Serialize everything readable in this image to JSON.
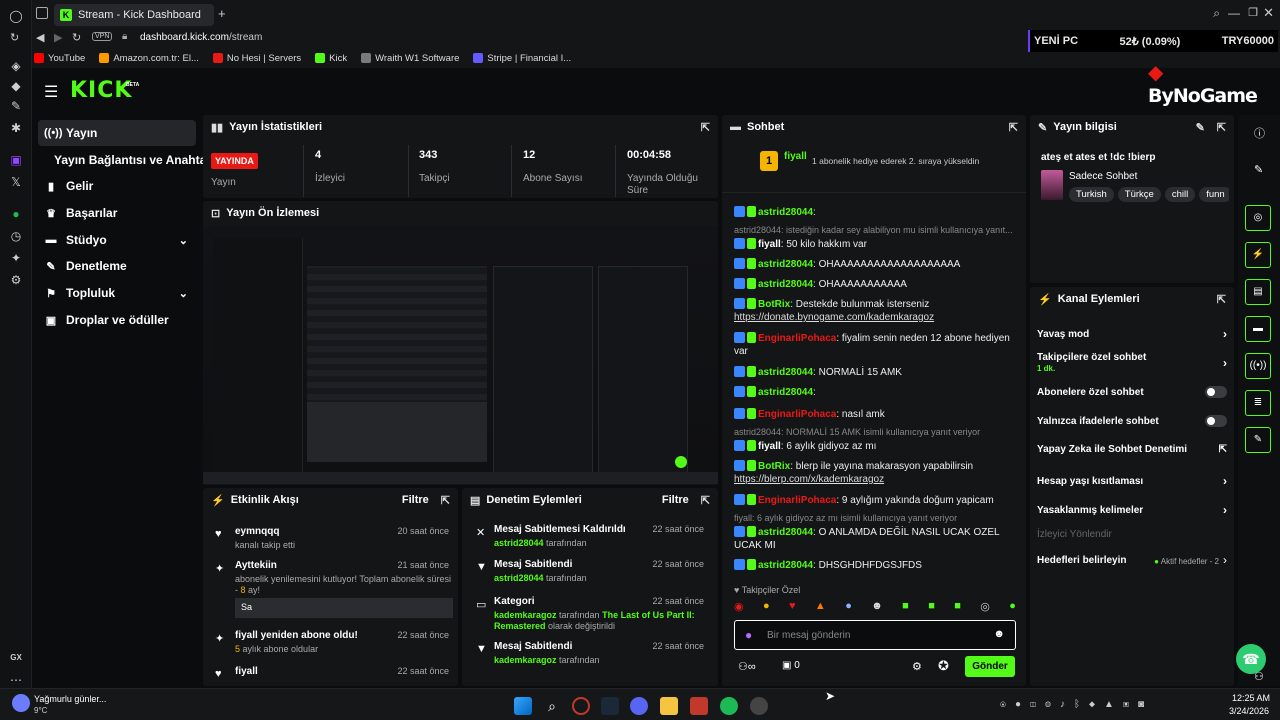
{
  "browser": {
    "tab_title": "Stream - Kick Dashboard",
    "vpn_label": "VPN",
    "url_domain": "dashboard.kick.com",
    "url_path": "/stream",
    "bookmarks": [
      {
        "label": "YouTube",
        "color": "#ff0000"
      },
      {
        "label": "Amazon.com.tr: El...",
        "color": "#ff9900"
      },
      {
        "label": "No Hesi | Servers",
        "color": "#e91916"
      },
      {
        "label": "Kick",
        "color": "#53fc18"
      },
      {
        "label": "Wraith W1 Software",
        "color": "#7a7a7a"
      },
      {
        "label": "Stripe | Financial I...",
        "color": "#635bff"
      }
    ]
  },
  "ticker": {
    "left": "YENİ PC",
    "mid": "52₺ (0.09%)",
    "right": "TRY60000"
  },
  "overlay_brand": {
    "name": "ByNoGame"
  },
  "brand": {
    "logo": "KICK",
    "beta": "BETA"
  },
  "sidenav": {
    "items": [
      {
        "label": "Yayın",
        "icon": "broadcast-icon"
      },
      {
        "label": "Yayın Bağlantısı ve Anahtarı",
        "icon": ""
      },
      {
        "label": "Gelir",
        "icon": "chart-icon"
      },
      {
        "label": "Başarılar",
        "icon": "trophy-icon"
      },
      {
        "label": "Stüdyo",
        "icon": "studio-icon"
      },
      {
        "label": "Denetleme",
        "icon": "wrench-icon"
      },
      {
        "label": "Topluluk",
        "icon": "people-icon"
      },
      {
        "label": "Droplar ve ödüller",
        "icon": "gift-icon"
      }
    ]
  },
  "stats": {
    "title": "Yayın İstatistikleri",
    "live_badge": "YAYINDA",
    "live_label": "Yayın",
    "viewers_value": "4",
    "viewers_label": "İzleyici",
    "followers_value": "343",
    "followers_label": "Takipçi",
    "subs_value": "12",
    "subs_label": "Abone Sayısı",
    "uptime_value": "00:04:58",
    "uptime_label": "Yayında Olduğu Süre"
  },
  "preview": {
    "title": "Yayın Ön İzlemesi"
  },
  "activity": {
    "title": "Etkinlik Akışı",
    "filter": "Filtre",
    "items": [
      {
        "name": "eymnqqq",
        "time": "20 saat önce",
        "sub": "kanalı takip etti"
      },
      {
        "name": "Ayttekiin",
        "time": "21 saat önce",
        "sub": "abonelik yenilemesini kutluyor! Toplam abonelik süresi -",
        "sub2": "8",
        "sub3": " ay!",
        "msg": "Sa"
      },
      {
        "name": "fiyall yeniden abone oldu!",
        "time": "22 saat önce",
        "sub2": "5",
        "sub": " aylık abone oldular"
      },
      {
        "name": "fiyall",
        "time": "22 saat önce"
      }
    ]
  },
  "modlog": {
    "title": "Denetim Eylemleri",
    "filter": "Filtre",
    "items": [
      {
        "title": "Mesaj Sabitlemesi Kaldırıldı",
        "time": "22 saat önce",
        "who": "astrid28044",
        "by": " tarafından"
      },
      {
        "title": "Mesaj Sabitlendi",
        "time": "22 saat önce",
        "who": "astrid28044",
        "by": " tarafından"
      },
      {
        "title": "Kategori",
        "time": "22 saat önce",
        "who": "kademkaragoz",
        "by": " tarafından ",
        "game": "The Last of Us Part II: Remastered",
        "tail": " olarak değiştirildi"
      },
      {
        "title": "Mesaj Sabitlendi",
        "time": "22 saat önce",
        "who": "kademkaragoz",
        "by": " tarafından"
      }
    ]
  },
  "chat": {
    "title": "Sohbet",
    "pinned_user": "fiyall",
    "pinned_count": "1",
    "pinned_text": "1 abonelik hediye ederek 2. sıraya yükseldin",
    "followers_only": "Takipçiler Özel",
    "input_placeholder": "Bir mesaj gönderin",
    "points": "0",
    "send": "Gönder",
    "lines": [
      {
        "user": "astrid28044",
        "color": "green",
        "text": ": "
      },
      {
        "reply": "astrid28044: istediğin kadar sey alabiliyon mu isimli kullanıcıya yanıt..."
      },
      {
        "user": "fiyall",
        "color": "white",
        "text": ": 50 kilo hakkım var"
      },
      {
        "user": "astrid28044",
        "color": "green",
        "text": ": OHAAAAAAAAAAAAAAAAAAA"
      },
      {
        "user": "astrid28044",
        "color": "green",
        "text": ": OHAAAAAAAAAAA"
      },
      {
        "user": "BotRix",
        "color": "green",
        "text": ": Destekde bulunmak isterseniz",
        "link": "https://donate.bynogame.com/kademkaragoz"
      },
      {
        "user": "EnginarliPohaca",
        "color": "red",
        "text": ": fiyalim senin neden 12 abone hediyen var"
      },
      {
        "user": "astrid28044",
        "color": "green",
        "text": ": NORMALİ 15 AMK"
      },
      {
        "user": "astrid28044",
        "color": "green",
        "text": ": "
      },
      {
        "user": "EnginarliPohaca",
        "color": "red",
        "text": ": nasıl amk"
      },
      {
        "reply": "astrid28044: NORMALİ 15 AMK isimli kullanıcıya yanıt veriyor"
      },
      {
        "user": "fiyall",
        "color": "white",
        "text": ": 6 aylık gidiyoz az mı"
      },
      {
        "user": "BotRix",
        "color": "green",
        "text": ": blerp ile yayına makarasyon yapabilirsin",
        "link": "https://blerp.com/x/kademkaragoz"
      },
      {
        "user": "EnginarliPohaca",
        "color": "red",
        "text": ": 9 aylığım yakında doğum yapicam"
      },
      {
        "reply": "fiyall: 6 aylık gidiyoz az mı isimli kullanıcıya yanıt veriyor"
      },
      {
        "user": "astrid28044",
        "color": "green",
        "text": ": O ANLAMDA DEĞİL NASIL UCAK OZEL UCAK MI"
      },
      {
        "user": "astrid28044",
        "color": "green",
        "text": ": DHSGHDHFDGSJFDS"
      }
    ]
  },
  "info": {
    "title": "Yayın bilgisi",
    "stream_title": "ateş et ates et !dc !bierp",
    "category": "Sadece Sohbet",
    "tags": [
      "Turkish",
      "Türkçe",
      "chill",
      "funn"
    ]
  },
  "channel_actions": {
    "title": "Kanal Eylemleri",
    "items": [
      {
        "label": "Yavaş mod",
        "type": "arrow"
      },
      {
        "label": "Takipçilere özel sohbet",
        "type": "arrow",
        "sub": "1 dk."
      },
      {
        "label": "Abonelere özel sohbet",
        "type": "toggle"
      },
      {
        "label": "Yalnızca ifadelerle sohbet",
        "type": "toggle"
      },
      {
        "label": "Yapay Zeka ile Sohbet Denetimi",
        "type": "ext"
      },
      {
        "label": "Hesap yaşı kısıtlaması",
        "type": "arrow"
      },
      {
        "label": "Yasaklanmış kelimeler",
        "type": "arrow"
      },
      {
        "label": "İzleyici Yönlendir",
        "type": "disabled"
      },
      {
        "label": "Hedefleri belirleyin",
        "type": "goal",
        "extra": "Aktif hedefler - 2"
      }
    ]
  },
  "taskbar": {
    "weather_title": "Yağmurlu günler...",
    "weather_temp": "9°C",
    "time": "12:25 AM",
    "date": "3/24/2026",
    "gx": "GX"
  }
}
